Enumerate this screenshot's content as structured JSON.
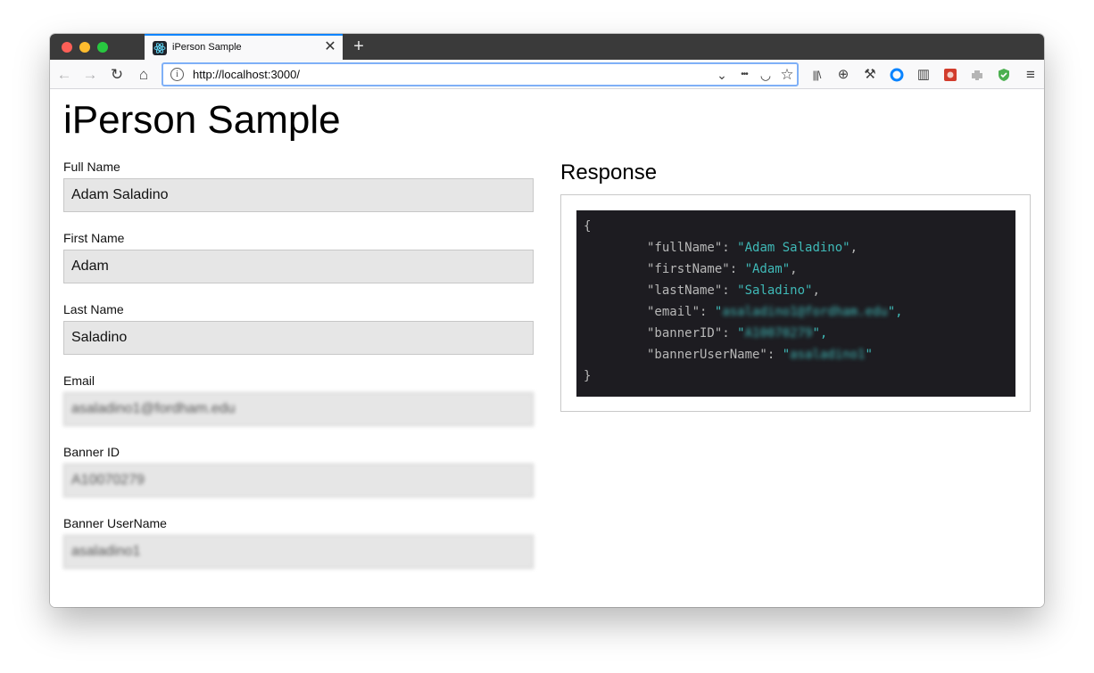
{
  "browser": {
    "tab_title": "iPerson Sample",
    "tab_close": "✕",
    "new_tab": "+",
    "url": "http://localhost:3000/",
    "url_info": "i",
    "nav": {
      "back": "←",
      "forward": "→",
      "reload": "↻",
      "home": "⌂"
    },
    "url_actions": {
      "dropdown": "⌄",
      "more": "•••",
      "pocket": "◡",
      "bookmark": "☆"
    },
    "toolbar": {
      "library": "|||\\",
      "translate": "⊕",
      "devtools": "⚒",
      "sidebar": "▥",
      "menu": "≡"
    }
  },
  "page": {
    "title": "iPerson Sample"
  },
  "form": {
    "fields": [
      {
        "label": "Full Name",
        "value": "Adam Saladino"
      },
      {
        "label": "First Name",
        "value": "Adam"
      },
      {
        "label": "Last Name",
        "value": "Saladino"
      },
      {
        "label": "Email",
        "value": "asaladino1@fordham.edu"
      },
      {
        "label": "Banner ID",
        "value": "A10070279"
      },
      {
        "label": "Banner UserName",
        "value": "asaladino1"
      }
    ]
  },
  "response": {
    "title": "Response",
    "open_brace": "{",
    "close_brace": "}",
    "lines": [
      {
        "key": "\"fullName\"",
        "sep": ": ",
        "value": "\"Adam Saladino\"",
        "trail": ","
      },
      {
        "key": "\"firstName\"",
        "sep": ": ",
        "value": "\"Adam\"",
        "trail": ","
      },
      {
        "key": "\"lastName\"",
        "sep": ": ",
        "value": "\"Saladino\"",
        "trail": ","
      },
      {
        "key": "\"email\"",
        "sep": ": ",
        "quote": "\"",
        "value": "asaladino1@fordham.edu",
        "trail": "\","
      },
      {
        "key": "\"bannerID\"",
        "sep": ": ",
        "quote": "\"",
        "value": "A10070279",
        "trail": "\","
      },
      {
        "key": "\"bannerUserName\"",
        "sep": ": ",
        "quote": "\"",
        "value": "asaladino1",
        "trail": "\""
      }
    ]
  },
  "colors": {
    "accent_tab": "#0a84ff",
    "urlbar_focus": "#7fb0f7",
    "code_bg": "#1d1c21",
    "code_string": "#3fb9b7",
    "input_bg": "#e6e6e6"
  }
}
